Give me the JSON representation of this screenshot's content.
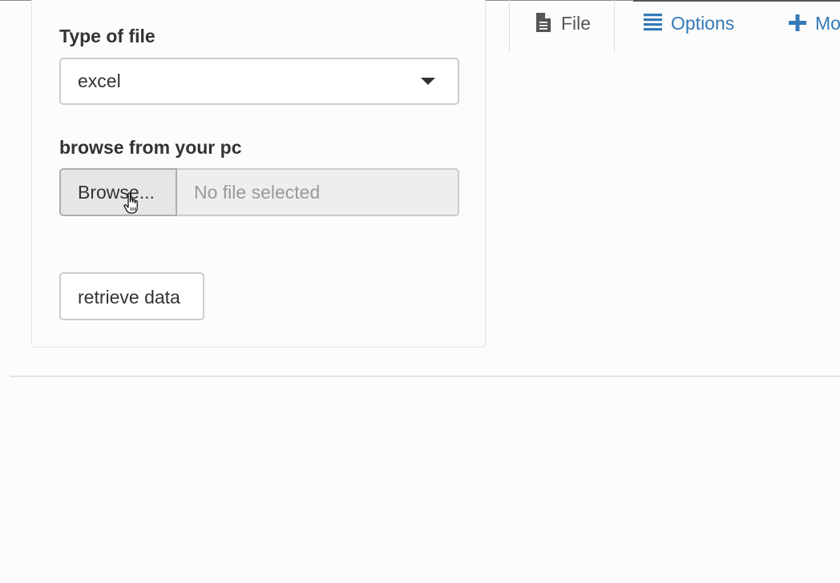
{
  "form": {
    "file_type": {
      "label": "Type of file",
      "selected": "excel"
    },
    "upload": {
      "label": "browse from your pc",
      "browse_label": "Browse...",
      "placeholder": "No file selected"
    },
    "retrieve_label": "retrieve data"
  },
  "tabs": [
    {
      "label": "File",
      "icon": "file-icon",
      "active": true
    },
    {
      "label": "Options",
      "icon": "list-icon",
      "active": false
    },
    {
      "label": "Mo",
      "icon": "plus-icon",
      "active": false
    }
  ],
  "colors": {
    "active_tab": "#555555",
    "link_tab": "#337ab7",
    "panel_bg": "#fcfcfc",
    "input_border": "#cccccc"
  }
}
